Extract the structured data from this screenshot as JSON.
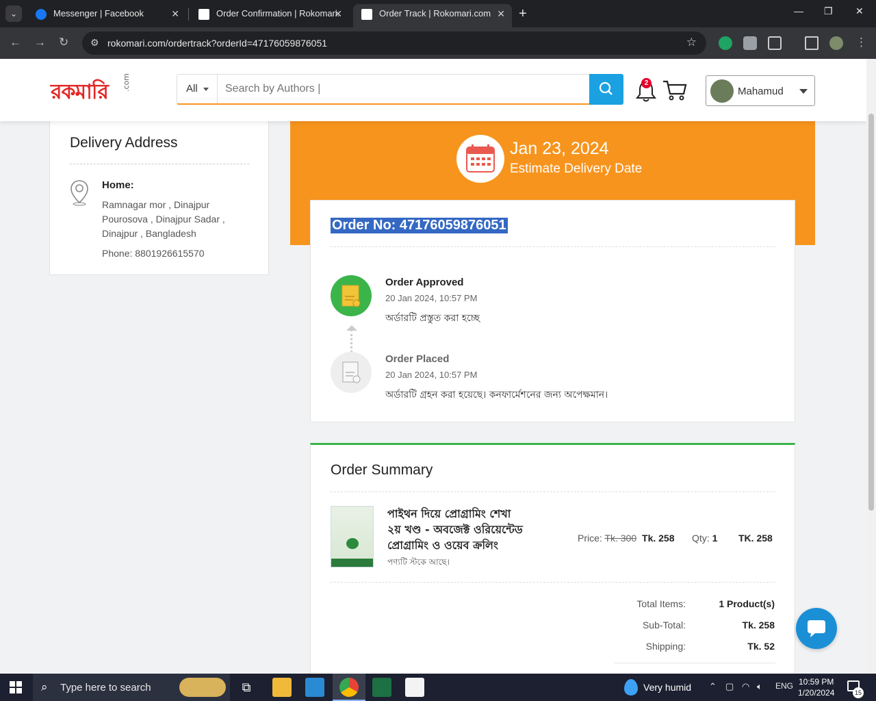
{
  "browser": {
    "tabs": [
      {
        "title": "Messenger | Facebook",
        "active": false
      },
      {
        "title": "Order Confirmation | Rokomari.",
        "active": false
      },
      {
        "title": "Order Track | Rokomari.com",
        "active": true
      }
    ],
    "url": "rokomari.com/ordertrack?orderId=47176059876051"
  },
  "header": {
    "logo_text": "রকমারি",
    "logo_domain": ".com",
    "search_category": "All",
    "search_placeholder": "Search by Authors |",
    "notification_count": "2",
    "user_name": "Mahamud"
  },
  "address": {
    "title": "Delivery Address",
    "label": "Home:",
    "lines": [
      "Ramnagar mor , Dinajpur",
      "Pourosova , Dinajpur Sadar ,",
      "Dinajpur , Bangladesh"
    ],
    "phone": "Phone: 8801926615570"
  },
  "delivery": {
    "date": "Jan 23, 2024",
    "label": "Estimate Delivery Date"
  },
  "tracking": {
    "order_no": "Order No: 47176059876051",
    "steps": [
      {
        "title": "Order Approved",
        "time": "20 Jan 2024, 10:57 PM",
        "desc": "অর্ডারটি প্রস্তুত করা হচ্ছে",
        "color": "#3bb54a"
      },
      {
        "title": "Order Placed",
        "time": "20 Jan 2024, 10:57 PM",
        "desc": "অর্ডারটি গ্রহন করা হয়েছে। কনফার্মেশনের জন্য অপেক্ষমান।",
        "color": "#eeeeee"
      }
    ]
  },
  "summary": {
    "title": "Order Summary",
    "item": {
      "title": "পাইথন দিয়ে প্রোগ্রামিং শেখা ২য় খণ্ড - অবজেক্ট ওরিয়েন্টেড প্রোগ্রামিং ও ওয়েব ক্রলিং",
      "stock": "পণ্যটি স্টকে আছে।",
      "price_label": "Price:",
      "old_price": "Tk. 300",
      "new_price": "Tk. 258",
      "qty_label": "Qty:",
      "qty": "1",
      "total": "TK. 258"
    },
    "totals": [
      {
        "label": "Total Items:",
        "value": "1 Product(s)"
      },
      {
        "label": "Sub-Total:",
        "value": "Tk. 258"
      },
      {
        "label": "Shipping:",
        "value": "Tk. 52"
      }
    ]
  },
  "taskbar": {
    "search_text": "Type here to search",
    "weather": "Very humid",
    "lang": "ENG",
    "time": "10:59 PM",
    "date": "1/20/2024",
    "notification_count": "15"
  },
  "colors": {
    "brand_orange": "#f7941d",
    "brand_blue": "#1ba1e2",
    "approved_green": "#3bb54a",
    "selection_blue": "#3468c3"
  }
}
